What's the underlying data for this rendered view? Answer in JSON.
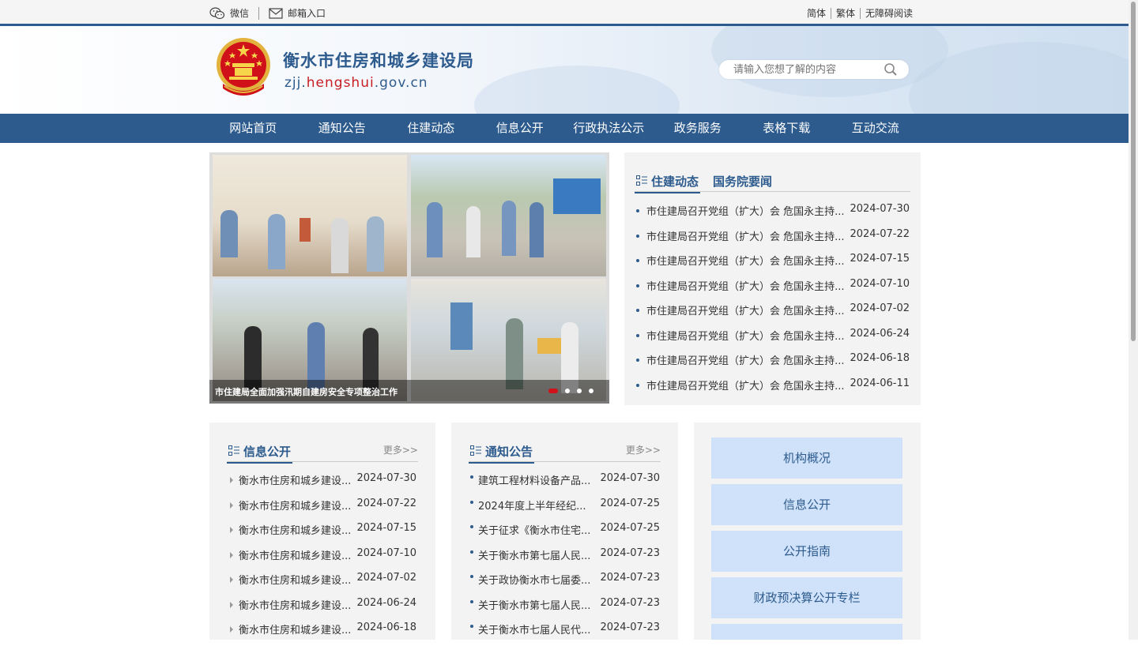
{
  "topbar": {
    "wechat_label": "微信",
    "mail_label": "邮箱入口",
    "simplified": "简体",
    "traditional": "繁体",
    "accessible": "无障碍阅读"
  },
  "header": {
    "site_name": "衡水市住房和城乡建设局",
    "url_prefix": "zjj.",
    "url_highlight": "hengshui",
    "url_suffix": ".gov.cn",
    "search_placeholder": "请输入您想了解的内容"
  },
  "nav": [
    "网站首页",
    "通知公告",
    "住建动态",
    "信息公开",
    "行政执法公示",
    "政务服务",
    "表格下载",
    "互动交流"
  ],
  "slider": {
    "caption": "市住建局全面加强汛期自建房安全专项整治工作",
    "slide_count": 4,
    "active_slide": 1
  },
  "news_panel": {
    "tabs": [
      "住建动态",
      "国务院要闻"
    ],
    "active_tab": 0,
    "items": [
      {
        "title": "市住建局召开党组（扩大）会 危国永主持...",
        "date": "2024-07-30"
      },
      {
        "title": "市住建局召开党组（扩大）会 危国永主持...",
        "date": "2024-07-22"
      },
      {
        "title": "市住建局召开党组（扩大）会 危国永主持...",
        "date": "2024-07-15"
      },
      {
        "title": "市住建局召开党组（扩大）会 危国永主持...",
        "date": "2024-07-10"
      },
      {
        "title": "市住建局召开党组（扩大）会 危国永主持...",
        "date": "2024-07-02"
      },
      {
        "title": "市住建局召开党组（扩大）会 危国永主持...",
        "date": "2024-06-24"
      },
      {
        "title": "市住建局召开党组（扩大）会 危国永主持...",
        "date": "2024-06-18"
      },
      {
        "title": "市住建局召开党组（扩大）会 危国永主持...",
        "date": "2024-06-11"
      }
    ]
  },
  "info_panel": {
    "title": "信息公开",
    "more": "更多>>",
    "items": [
      {
        "title": "衡水市住房和城乡建设...",
        "date": "2024-07-30"
      },
      {
        "title": "衡水市住房和城乡建设...",
        "date": "2024-07-22"
      },
      {
        "title": "衡水市住房和城乡建设...",
        "date": "2024-07-15"
      },
      {
        "title": "衡水市住房和城乡建设...",
        "date": "2024-07-10"
      },
      {
        "title": "衡水市住房和城乡建设...",
        "date": "2024-07-02"
      },
      {
        "title": "衡水市住房和城乡建设...",
        "date": "2024-06-24"
      },
      {
        "title": "衡水市住房和城乡建设...",
        "date": "2024-06-18"
      }
    ]
  },
  "notice_panel": {
    "title": "通知公告",
    "more": "更多>>",
    "items": [
      {
        "title": "建筑工程材料设备产品...",
        "date": "2024-07-30"
      },
      {
        "title": "2024年度上半年经纪...",
        "date": "2024-07-25"
      },
      {
        "title": "关于征求《衡水市住宅...",
        "date": "2024-07-25"
      },
      {
        "title": "关于衡水市第七届人民...",
        "date": "2024-07-23"
      },
      {
        "title": "关于政协衡水市七届委...",
        "date": "2024-07-23"
      },
      {
        "title": "关于衡水市第七届人民...",
        "date": "2024-07-23"
      },
      {
        "title": "关于衡水市七届人民代...",
        "date": "2024-07-23"
      }
    ]
  },
  "quick_links": [
    "机构概况",
    "信息公开",
    "公开指南",
    "财政预决算公开专栏",
    ""
  ],
  "colors": {
    "primary": "#2d5b8e",
    "accent_red": "#c71d23",
    "quick_link_bg": "#cfe2f9",
    "panel_bg": "#f3f3f3"
  }
}
